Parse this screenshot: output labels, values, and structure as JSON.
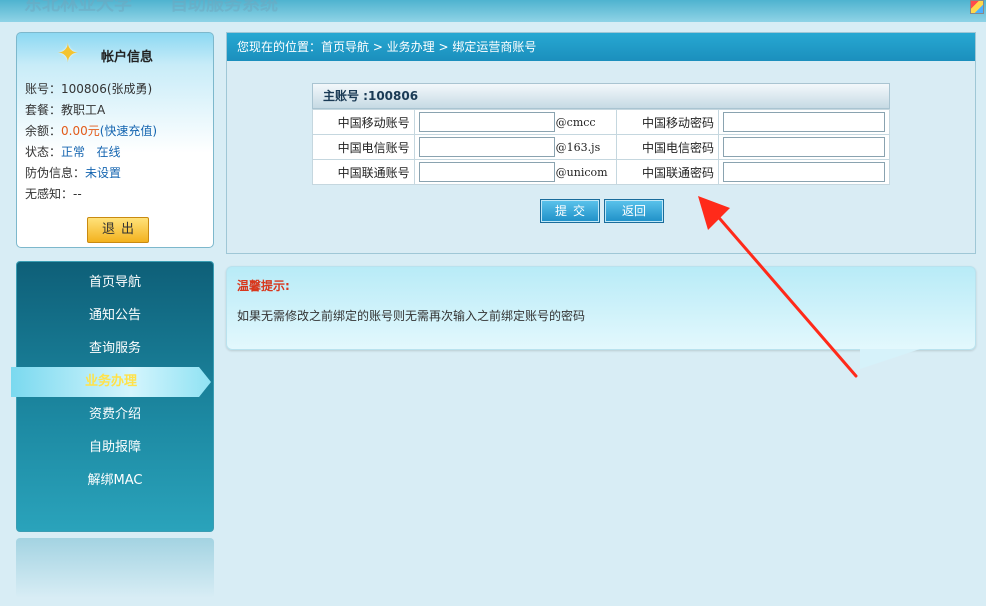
{
  "banner": {
    "ghost_text_1": "东北林业大学",
    "ghost_text_2": "自助服务系统"
  },
  "account": {
    "title": "帐户信息",
    "rows": [
      {
        "label": "账号：",
        "value": "100806(张成勇)"
      },
      {
        "label": "套餐：",
        "value": "教职工A"
      },
      {
        "label": "余额：",
        "value": "0.00元",
        "link": "(快速充值)"
      },
      {
        "label": "状态：",
        "value": "正常",
        "value2": "在线"
      },
      {
        "label": "防伪信息：",
        "value": "未设置"
      },
      {
        "label": "无感知：",
        "value": "--"
      }
    ],
    "logout_label": "退出"
  },
  "nav": {
    "items": [
      {
        "label": "首页导航"
      },
      {
        "label": "通知公告"
      },
      {
        "label": "查询服务"
      },
      {
        "label": "业务办理",
        "active": true
      },
      {
        "label": "资费介绍"
      },
      {
        "label": "自助报障"
      },
      {
        "label": "解绑MAC"
      }
    ]
  },
  "main": {
    "breadcrumb": "您现在的位置：首页导航 > 业务办理 > 绑定运营商账号",
    "table_title": "主账号 :100806",
    "rows": [
      {
        "account_label": "中国移动账号",
        "suffix": "@cmcc",
        "password_label": "中国移动密码",
        "account_value": "",
        "password_value": ""
      },
      {
        "account_label": "中国电信账号",
        "suffix": "@163.js",
        "password_label": "中国电信密码",
        "account_value": "",
        "password_value": ""
      },
      {
        "account_label": "中国联通账号",
        "suffix": "@unicom",
        "password_label": "中国联通密码",
        "account_value": "",
        "password_value": ""
      }
    ],
    "submit_label": "提交",
    "back_label": "返回"
  },
  "tip": {
    "title": "温馨提示:",
    "text": "如果无需修改之前绑定的账号则无需再次输入之前绑定账号的密码"
  },
  "colors": {
    "accent": "#1b8fbd",
    "nav_bg": "#0e5f78",
    "active_text": "#ffe24a",
    "warning": "#d8371c",
    "annotation": "#ff2a1a"
  }
}
